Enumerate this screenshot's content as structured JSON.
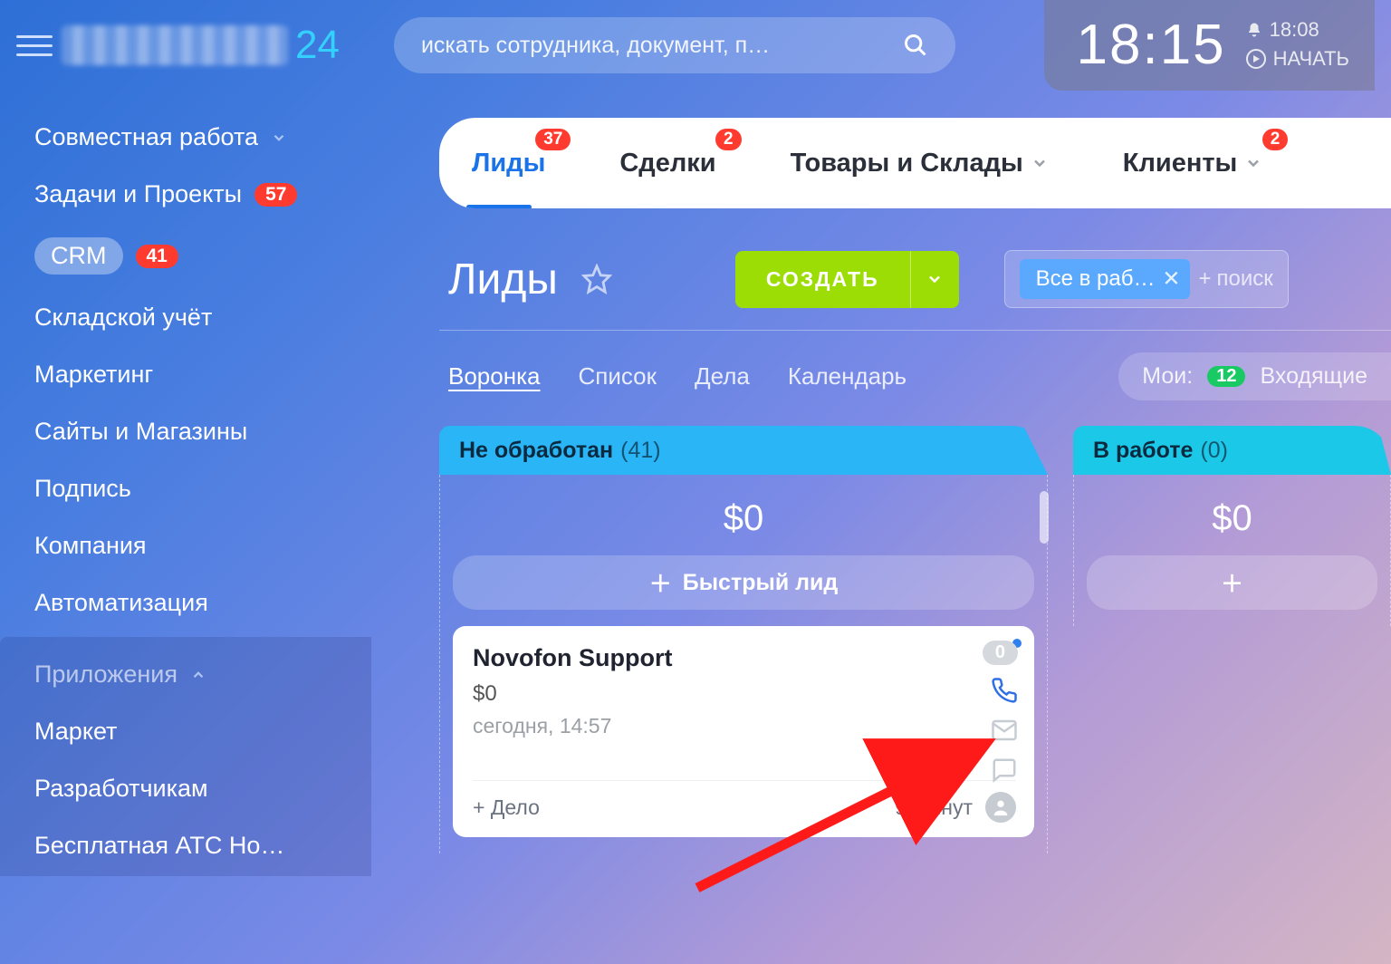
{
  "brand_suffix": "24",
  "search": {
    "placeholder": "искать сотрудника, документ, п…"
  },
  "clock": {
    "time": "18:15",
    "notif_time": "18:08",
    "start_label": "НАЧАТЬ"
  },
  "sidebar": {
    "items": [
      {
        "label": "Совместная работа",
        "chevron": true
      },
      {
        "label": "Задачи и Проекты",
        "badge": "57"
      },
      {
        "label": "CRM",
        "badge": "41",
        "active": true
      },
      {
        "label": "Складской учёт"
      },
      {
        "label": "Маркетинг"
      },
      {
        "label": "Сайты и Магазины"
      },
      {
        "label": "Подпись"
      },
      {
        "label": "Компания"
      },
      {
        "label": "Автоматизация"
      }
    ],
    "apps_header": "Приложения",
    "apps": [
      {
        "label": "Маркет"
      },
      {
        "label": "Разработчикам"
      },
      {
        "label": "Бесплатная АТС Но…"
      }
    ]
  },
  "tabs": [
    {
      "label": "Лиды",
      "badge": "37",
      "active": true
    },
    {
      "label": "Сделки",
      "badge": "2"
    },
    {
      "label": "Товары и Склады",
      "chevron": true
    },
    {
      "label": "Клиенты",
      "badge": "2",
      "chevron": true
    }
  ],
  "page": {
    "title": "Лиды",
    "create": "СОЗДАТЬ"
  },
  "filter": {
    "chip": "Все в раб…",
    "search_label": "поиск"
  },
  "views": [
    "Воронка",
    "Список",
    "Дела",
    "Календарь"
  ],
  "views_active": 0,
  "mine": {
    "label": "Мои:",
    "count": "12",
    "incoming": "Входящие"
  },
  "columns": [
    {
      "title": "Не обработан",
      "count": "(41)",
      "sum": "$0",
      "quick": "Быстрый лид"
    },
    {
      "title": "В работе",
      "count": "(0)",
      "sum": "$0"
    }
  ],
  "lead": {
    "title": "Novofon Support",
    "amount": "$0",
    "date": "сегодня, 14:57",
    "badge": "0",
    "add_task": "+ Дело",
    "duration": "9 Минут"
  }
}
